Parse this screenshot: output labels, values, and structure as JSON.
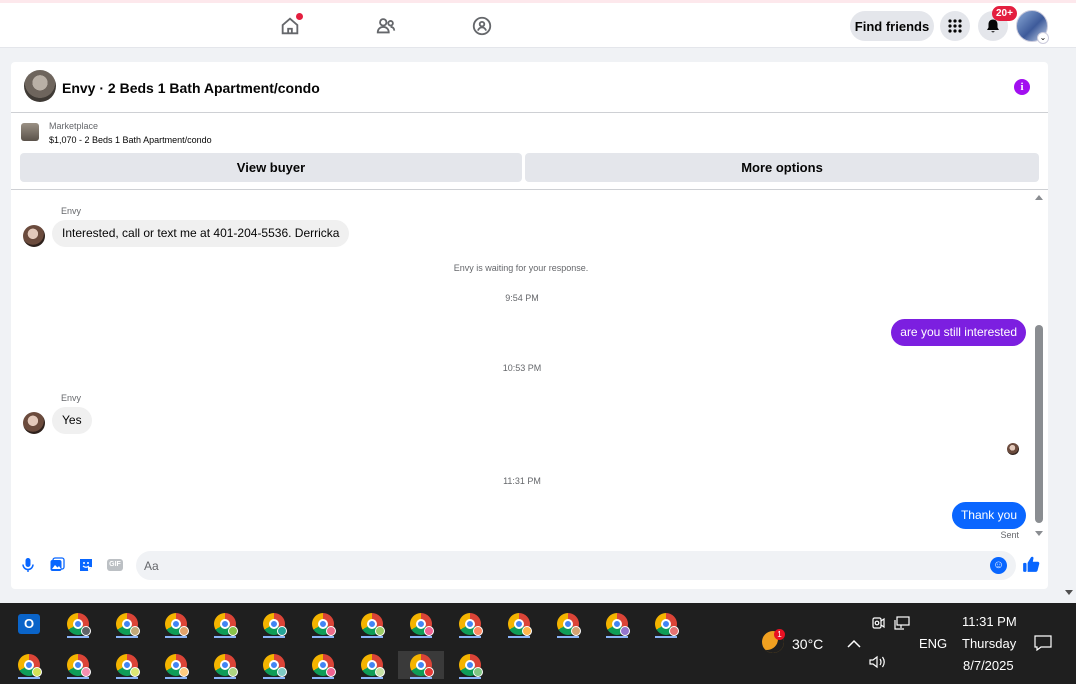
{
  "topnav": {
    "items": [
      {
        "name": "home",
        "icon": "home-icon",
        "has_notification_dot": true
      },
      {
        "name": "friends",
        "icon": "friends-icon"
      },
      {
        "name": "groups",
        "icon": "groups-icon"
      }
    ],
    "find_friends_label": "Find friends",
    "menu_icon": "grid-menu-icon",
    "notifications_icon": "bell-icon",
    "notifications_count": "20+",
    "profile_dropdown_glyph": "⌄"
  },
  "chat": {
    "title": "Envy · 2 Beds 1 Bath Apartment/condo",
    "info_glyph": "i",
    "marketplace": {
      "label": "Marketplace",
      "listing": "$1,070 - 2 Beds 1 Bath Apartment/condo",
      "view_buyer_label": "View buyer",
      "more_options_label": "More options"
    },
    "messages": {
      "m1_sender": "Envy",
      "m1_text": "Interested, call or text me at 401-204-5536. Derricka",
      "waiting_note": "Envy is waiting for your response.",
      "time1": "9:54 PM",
      "m2_text": "are you still interested",
      "time2": "10:53 PM",
      "m3_sender": "Envy",
      "m3_text": "Yes",
      "time3": "11:31 PM",
      "m4_text": "Thank you",
      "m4_status": "Sent"
    },
    "composer": {
      "placeholder": "Aa",
      "icons": [
        "microphone-icon",
        "photo-icon",
        "sticker-icon",
        "gif-icon"
      ],
      "gif_label": "GIF",
      "emoji_glyph": "☺",
      "like_icon": "thumbs-up-icon"
    },
    "colors": {
      "outgoing_purple": "#7c1fe0",
      "outgoing_blue": "#0a66ff",
      "accent": "#0866ff",
      "info_purple": "#a20ff0"
    }
  },
  "taskbar": {
    "outlook_letter": "O",
    "weather_badge": "1",
    "temperature": "30°C",
    "language": "ENG",
    "time": "11:31 PM",
    "day": "Thursday",
    "date": "8/7/2025"
  }
}
